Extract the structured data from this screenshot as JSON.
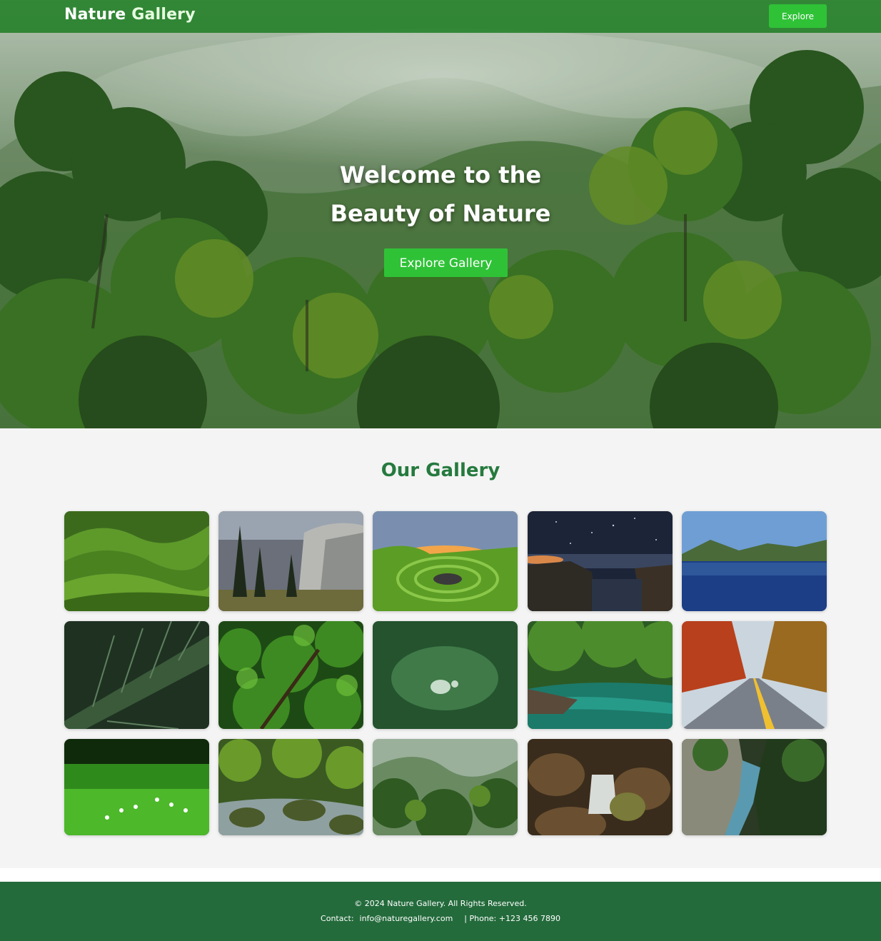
{
  "navbar": {
    "brand_part1": "Nature ",
    "brand_part2": "Gallery",
    "explore_label": "Explore"
  },
  "hero": {
    "title_line1": "Welcome to the",
    "title_line2": "Beauty of Nature",
    "cta_label": "Explore Gallery"
  },
  "gallery": {
    "title": "Our Gallery",
    "images": [
      {
        "subject": "rolling green hills"
      },
      {
        "subject": "granite cliff with pine trees"
      },
      {
        "subject": "spiral grass at sunset"
      },
      {
        "subject": "starry night over rocky coast"
      },
      {
        "subject": "mountain lake reflection"
      },
      {
        "subject": "dark green leaf close-up"
      },
      {
        "subject": "dense jungle"
      },
      {
        "subject": "water droplet on leaf"
      },
      {
        "subject": "turquoise forest river"
      },
      {
        "subject": "autumn road"
      },
      {
        "subject": "grass with white flowers"
      },
      {
        "subject": "mossy rocks in stream"
      },
      {
        "subject": "misty forest valley"
      },
      {
        "subject": "waterfall among rocks"
      },
      {
        "subject": "river canyon"
      }
    ]
  },
  "footer": {
    "copyright": "© 2024 Nature Gallery. All Rights Reserved.",
    "contact_label": "Contact:",
    "email": "info@naturegallery.com",
    "phone": "| Phone: +123 456 7890"
  },
  "colors": {
    "accent_green": "#2fc237",
    "nav_green": "#167a1c",
    "heading_green": "#257a3e",
    "footer_green": "#246b3c",
    "gallery_bg": "#f4f4f4"
  },
  "icons": []
}
